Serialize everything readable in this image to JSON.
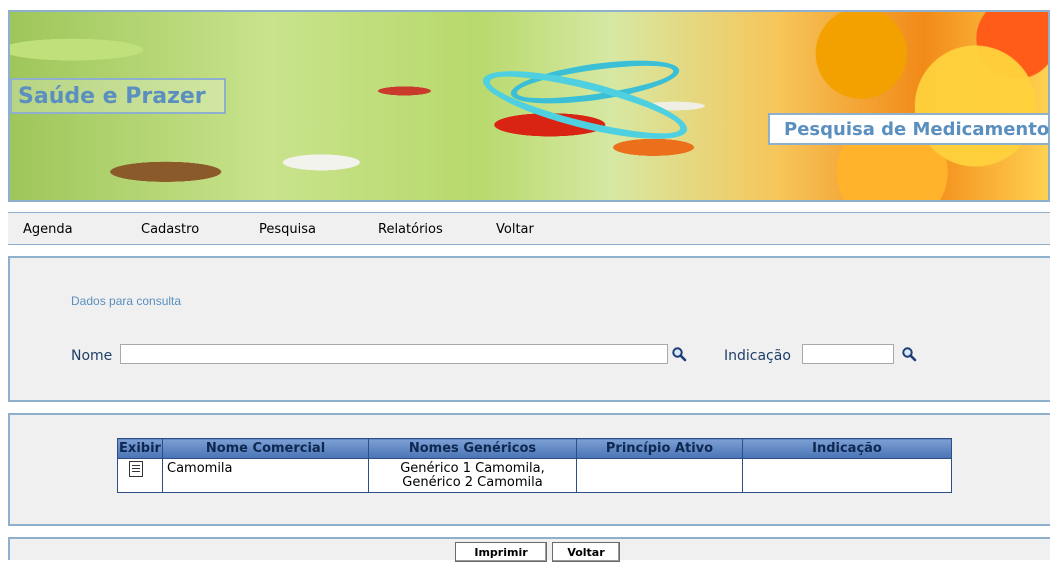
{
  "header": {
    "site_title": "Saúde e Prazer",
    "page_title": "Pesquisa de Medicamentos"
  },
  "menu": {
    "items": [
      {
        "label": "Agenda"
      },
      {
        "label": "Cadastro"
      },
      {
        "label": "Pesquisa"
      },
      {
        "label": "Relatórios"
      },
      {
        "label": "Voltar"
      }
    ]
  },
  "search": {
    "section_title": "Dados para consulta",
    "nome_label": "Nome",
    "nome_value": "",
    "indicacao_label": "Indicação",
    "indicacao_value": "",
    "search_icon": "magnifier-icon"
  },
  "results": {
    "columns": [
      "Exibir",
      "Nome Comercial",
      "Nomes Genéricos",
      "Princípio Ativo",
      "Indicação"
    ],
    "rows": [
      {
        "exibir_icon": "document-icon",
        "nome_comercial": "Camomila",
        "nomes_genericos_line1": "Genérico 1 Camomila,",
        "nomes_genericos_line2": "Genérico 2 Camomila",
        "principio_ativo": "",
        "indicacao": ""
      }
    ]
  },
  "footer": {
    "print_label": "Imprimir",
    "back_label": "Voltar"
  },
  "colors": {
    "accent": "#5a8fbf",
    "border": "#8fb0cc",
    "table_header": "#4a74b6"
  }
}
